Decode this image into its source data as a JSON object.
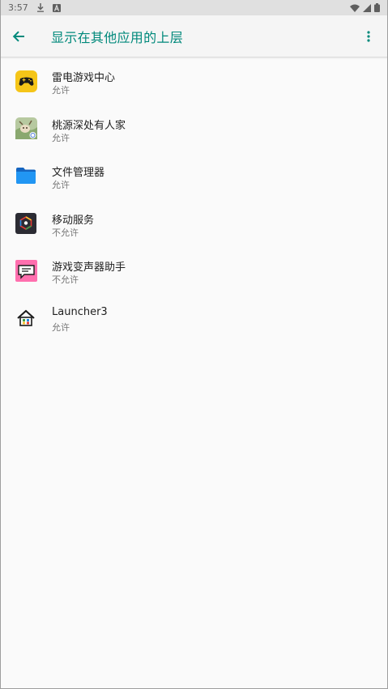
{
  "status_bar": {
    "time": "3:57",
    "icons_left": [
      "download-icon",
      "a-badge-icon"
    ],
    "icons_right": [
      "wifi-icon",
      "cell-signal-icon",
      "battery-icon"
    ]
  },
  "app_bar": {
    "title": "显示在其他应用的上层",
    "accent_color": "#00897b"
  },
  "apps": [
    {
      "name": "雷电游戏中心",
      "status": "允许",
      "icon": "gamepad-icon"
    },
    {
      "name": "桃源深处有人家",
      "status": "允许",
      "icon": "game-art-icon"
    },
    {
      "name": "文件管理器",
      "status": "允许",
      "icon": "folder-icon"
    },
    {
      "name": "移动服务",
      "status": "不允许",
      "icon": "mobile-service-icon"
    },
    {
      "name": "游戏变声器助手",
      "status": "不允许",
      "icon": "voice-changer-icon"
    },
    {
      "name": "Launcher3",
      "status": "允许",
      "icon": "home-icon"
    }
  ]
}
